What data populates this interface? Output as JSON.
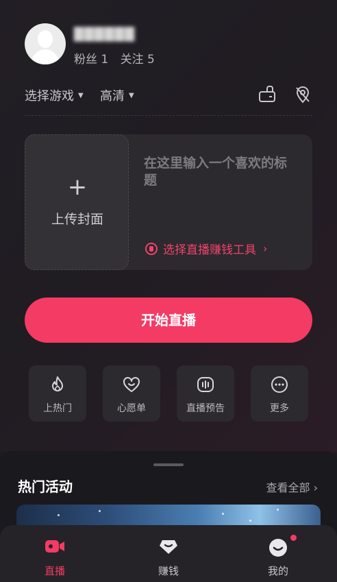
{
  "profile": {
    "username": "██████",
    "fans": "粉丝 1",
    "following": "关注 5"
  },
  "options": {
    "game": "选择游戏",
    "quality": "高清"
  },
  "setup": {
    "cover_plus": "+",
    "cover_label": "上传封面",
    "title_placeholder": "在这里输入一个喜欢的标题",
    "earn_tool": "选择直播赚钱工具",
    "earn_chevron": "›"
  },
  "start_button": "开始直播",
  "quick_actions": [
    {
      "label": "上热门",
      "icon": "flame-icon"
    },
    {
      "label": "心愿单",
      "icon": "heart-smile-icon"
    },
    {
      "label": "直播预告",
      "icon": "voice-wave-icon"
    },
    {
      "label": "更多",
      "icon": "more-dots-icon"
    }
  ],
  "hot_activities": {
    "title": "热门活动",
    "view_all": "查看全部 ›"
  },
  "tabbar": [
    {
      "label": "直播",
      "icon": "live-camera-icon",
      "active": true
    },
    {
      "label": "赚钱",
      "icon": "money-bag-icon",
      "active": false
    },
    {
      "label": "我的",
      "icon": "smile-face-icon",
      "active": false
    }
  ],
  "colors": {
    "accent": "#f43b64",
    "background": "#1d1b21",
    "card": "#2c292f"
  }
}
